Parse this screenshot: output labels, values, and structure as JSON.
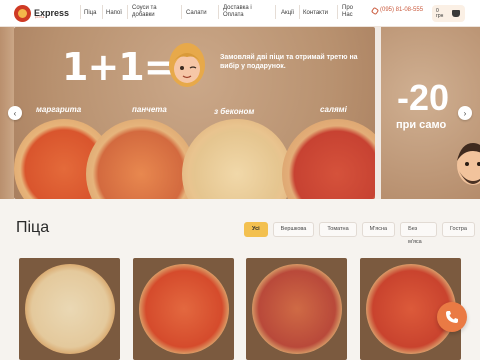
{
  "header": {
    "logo_text": "Express",
    "logo_sub": "pizza",
    "nav": [
      {
        "label": "Піца"
      },
      {
        "label": "Напої"
      },
      {
        "label": "Соуси та"
      },
      {
        "label": "добавки"
      },
      {
        "label": "Салати"
      },
      {
        "label": "Доставка і"
      },
      {
        "label": "Оплата"
      },
      {
        "label": "Акції"
      },
      {
        "label": "Контакти"
      },
      {
        "label": "Про"
      },
      {
        "label": "Нас"
      }
    ],
    "phone": "(095) 81-08-555",
    "cart_count": "0",
    "cart_unit": "грн"
  },
  "carousel": {
    "promo_big": "1+1=3",
    "promo_text": "Замовляй дві піци та отримай третю на вибір у подарунок.",
    "labels": [
      "маргарита",
      "панчета",
      "з беконом",
      "салямі"
    ],
    "next_big": "-20",
    "next_small": "при само",
    "prev_arrow": "‹",
    "next_arrow": "›"
  },
  "section": {
    "title": "Піца",
    "filters": [
      "Усі",
      "Вершкова",
      "Томатна",
      "М'ясна",
      "Без м'яса",
      "Гостра"
    ],
    "active_filter": 0
  },
  "colors": {
    "accent": "#f3c04f",
    "brand": "#cf3a24",
    "fab": "#ea7a44"
  },
  "icons": {
    "phone": "phone-icon",
    "cart": "cart-icon",
    "call_fab": "phone-call-icon"
  }
}
